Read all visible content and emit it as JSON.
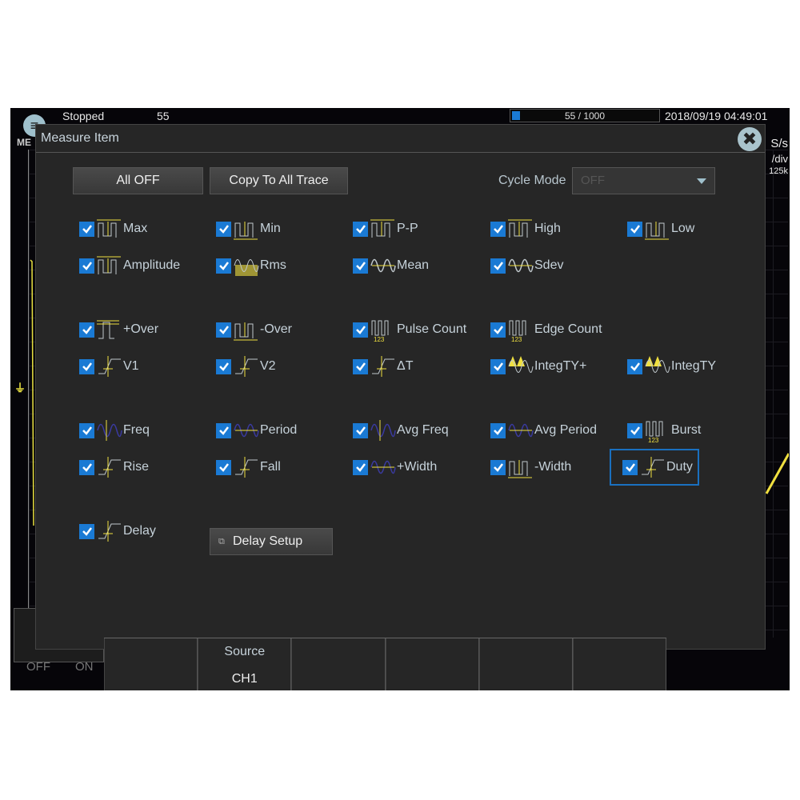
{
  "status": {
    "state": "Stopped",
    "count": "55",
    "progress_text": "55 / 1000",
    "progress_fraction": 0.055,
    "datetime": "2018/09/19 04:49:01",
    "menu_label": "ME",
    "rate_unit": "S/s",
    "div_unit": "/div",
    "record_len": "125k"
  },
  "dialog": {
    "title": "Measure Item",
    "all_off": "All OFF",
    "copy_all": "Copy To All Trace",
    "cycle_mode_label": "Cycle Mode",
    "cycle_mode_value": "OFF",
    "delay_setup": "Delay Setup"
  },
  "items": [
    {
      "label": "Max",
      "icon": "max-icon",
      "checked": true
    },
    {
      "label": "Min",
      "icon": "min-icon",
      "checked": true
    },
    {
      "label": "P-P",
      "icon": "pp-icon",
      "checked": true
    },
    {
      "label": "High",
      "icon": "high-icon",
      "checked": true
    },
    {
      "label": "Low",
      "icon": "low-icon",
      "checked": true
    },
    {
      "label": "Amplitude",
      "icon": "amplitude-icon",
      "checked": true
    },
    {
      "label": "Rms",
      "icon": "rms-icon",
      "checked": true
    },
    {
      "label": "Mean",
      "icon": "mean-icon",
      "checked": true
    },
    {
      "label": "Sdev",
      "icon": "sdev-icon",
      "checked": true
    },
    {
      "label": "+Over",
      "icon": "plus-over-icon",
      "checked": true
    },
    {
      "label": "-Over",
      "icon": "minus-over-icon",
      "checked": true
    },
    {
      "label": "Pulse Count",
      "icon": "pulse-count-icon",
      "checked": true
    },
    {
      "label": "Edge Count",
      "icon": "edge-count-icon",
      "checked": true
    },
    {
      "label": "V1",
      "icon": "v1-icon",
      "checked": true
    },
    {
      "label": "V2",
      "icon": "v2-icon",
      "checked": true
    },
    {
      "label": "ΔT",
      "icon": "delta-t-icon",
      "checked": true
    },
    {
      "label": "IntegTY+",
      "icon": "integ-plus-icon",
      "checked": true
    },
    {
      "label": "IntegTY",
      "icon": "integ-icon",
      "checked": true
    },
    {
      "label": "Freq",
      "icon": "freq-icon",
      "checked": true
    },
    {
      "label": "Period",
      "icon": "period-icon",
      "checked": true
    },
    {
      "label": "Avg Freq",
      "icon": "avg-freq-icon",
      "checked": true
    },
    {
      "label": "Avg Period",
      "icon": "avg-period-icon",
      "checked": true
    },
    {
      "label": "Burst",
      "icon": "burst-icon",
      "checked": true
    },
    {
      "label": "Rise",
      "icon": "rise-icon",
      "checked": true
    },
    {
      "label": "Fall",
      "icon": "fall-icon",
      "checked": true
    },
    {
      "label": "+Width",
      "icon": "plus-width-icon",
      "checked": true
    },
    {
      "label": "-Width",
      "icon": "minus-width-icon",
      "checked": true
    },
    {
      "label": "Duty",
      "icon": "duty-icon",
      "checked": true,
      "selected": true
    },
    {
      "label": "Delay",
      "icon": "delay-icon",
      "checked": true
    }
  ],
  "softkeys": [
    {
      "title": "",
      "value": ""
    },
    {
      "title": "Source",
      "value": "CH1"
    },
    {
      "title": "",
      "value": ""
    },
    {
      "title": "",
      "value": ""
    },
    {
      "title": "",
      "value": ""
    },
    {
      "title": "",
      "value": ""
    }
  ],
  "left_panel": {
    "off": "OFF",
    "on": "ON"
  },
  "colors": {
    "accent": "#1a7ad4",
    "trace": "#f0e040",
    "dialog_bg": "#262626"
  }
}
